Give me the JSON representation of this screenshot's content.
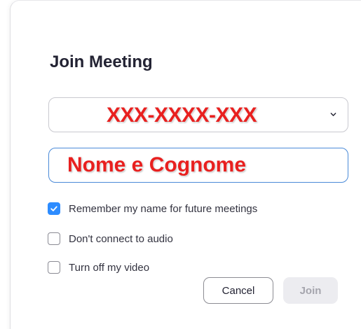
{
  "dialog": {
    "title": "Join Meeting"
  },
  "meeting_id": {
    "value": "XXX-XXXX-XXX"
  },
  "name": {
    "value": "Nome e Cognome"
  },
  "options": [
    {
      "label": "Remember my name for future meetings",
      "checked": true
    },
    {
      "label": "Don't connect to audio",
      "checked": false
    },
    {
      "label": "Turn off my video",
      "checked": false
    }
  ],
  "buttons": {
    "cancel_label": "Cancel",
    "join_label": "Join"
  },
  "colors": {
    "accent": "#2d8cff",
    "focus_border": "#4a8ad8",
    "overlay_text": "#e8201f",
    "disabled_bg": "#ececf0",
    "disabled_text": "#a5a5ad"
  },
  "icons": {
    "dropdown": "chevron-down-icon",
    "check": "checkmark-icon"
  }
}
